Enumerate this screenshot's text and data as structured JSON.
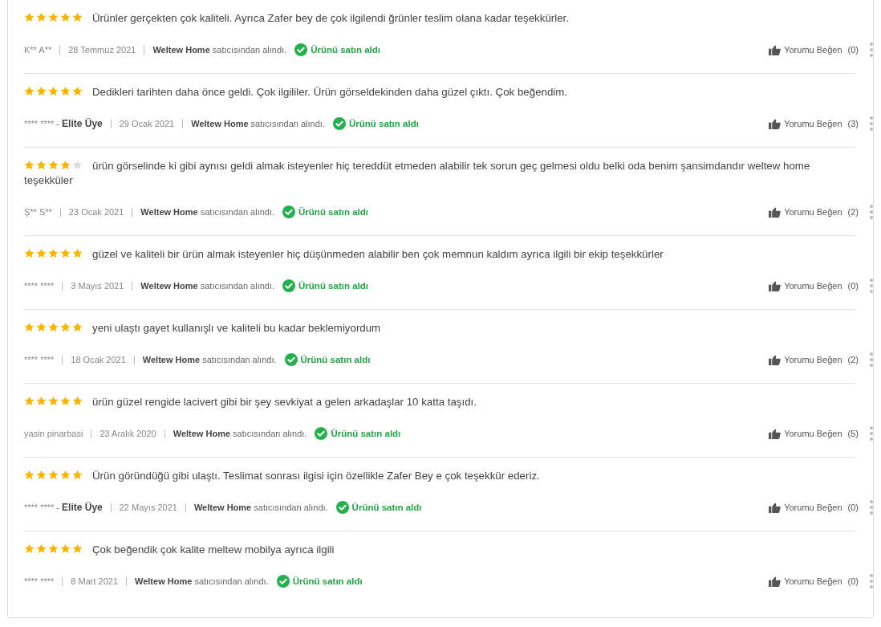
{
  "reviews": [
    {
      "stars": 5,
      "text": "Ürünler gerçekten çok kaliteli. Ayrıca Zafer bey de çok ilgilendi ğrünler teslim olana kadar teşekkürler.",
      "user": "K** A**",
      "date": "28 Temmuz 2021",
      "seller": "**Weltew Home** satıcısından alındı.",
      "purchased": "Ürünü satın aldı",
      "like_label": "Yorumu Beğen",
      "like_count": "(0)"
    },
    {
      "stars": 5,
      "text": "Dedikleri tarihten daha önce geldi. Çok ilgililer. Ürün görseldekinden daha güzel çıktı. Çok beğendim.",
      "user": "**** ****",
      "member": "- **Elite Üye**",
      "date": "29 Ocak 2021",
      "seller": "**Weltew Home** satıcısından alındı.",
      "purchased": "Ürünü satın aldı",
      "like_label": "Yorumu Beğen",
      "like_count": "(3)"
    },
    {
      "stars": 4,
      "text": "ürün görselinde ki gibi aynısı geldi almak isteyenler hiç tereddüt etmeden alabilir tek sorun geç gelmesi oldu belki oda benim şansimdandır weltew home teşekküler",
      "user": "Ş** S**",
      "date": "23 Ocak 2021",
      "seller": "**Weltew Home** satıcısından alındı.",
      "purchased": "Ürünü satın aldı",
      "like_label": "Yorumu Beğen",
      "like_count": "(2)"
    },
    {
      "stars": 5,
      "text": "güzel ve kaliteli bir ürün almak isteyenler hiç düşünmeden alabilir ben çok memnun kaldım ayrıca ilgili bir ekip teşekkürler",
      "user": "**** ****",
      "date": "3 Mayıs 2021",
      "seller": "**Weltew Home** satıcısından alındı.",
      "purchased": "Ürünü satın aldı",
      "like_label": "Yorumu Beğen",
      "like_count": "(0)"
    },
    {
      "stars": 5,
      "text": "yeni ulaştı gayet kullanışlı ve kaliteli bu kadar beklemiyordum",
      "user": "**** ****",
      "date": "18 Ocak 2021",
      "seller": "**Weltew Home** satıcısından alındı.",
      "purchased": "Ürünü satın aldı",
      "like_label": "Yorumu Beğen",
      "like_count": "(2)"
    },
    {
      "stars": 5,
      "text": "ürün güzel rengide lacivert gibi bir şey sevkiyat a gelen arkadaşlar 10 katta taşıdı.",
      "user": "yasin pinarbasi",
      "date": "23 Aralık 2020",
      "seller": "**Weltew Home** satıcısından alındı.",
      "purchased": "Ürünü satın aldı",
      "like_label": "Yorumu Beğen",
      "like_count": "(5)"
    },
    {
      "stars": 5,
      "text": "Ürün göründüğü gibi ulaştı. Teslimat sonrası ilgisi için özellikle Zafer Bey e çok teşekkür ederiz.",
      "user": "**** ****",
      "member": "- **Elite Üye**",
      "date": "22 Mayıs 2021",
      "seller": "**Weltew Home** satıcısından alındı.",
      "purchased": "Ürünü satın aldı",
      "like_label": "Yorumu Beğen",
      "like_count": "(0)"
    },
    {
      "stars": 5,
      "text": "Çok beğendik çok kalite meltew mobilya ayrıca ilgili",
      "user": "**** ****",
      "date": "8 Mart 2021",
      "seller": "**Weltew Home** satıcısından alındı.",
      "purchased": "Ürünü satın aldı",
      "like_label": "Yorumu Beğen",
      "like_count": "(0)"
    }
  ]
}
